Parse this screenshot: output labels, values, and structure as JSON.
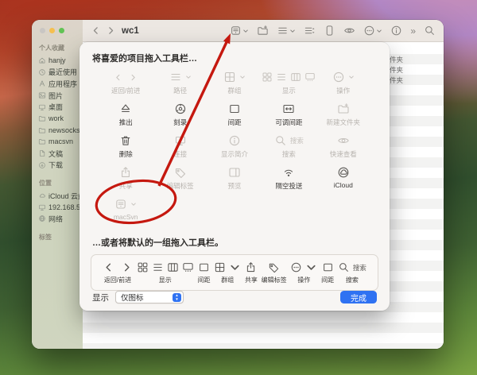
{
  "colors": {
    "accent_blue": "#2f72f2",
    "annotation_red": "#c5180f"
  },
  "window": {
    "title": "wc1",
    "toolbar_items": [
      {
        "id": "macsvn",
        "icon": "app",
        "chevron": true
      },
      {
        "id": "new-folder",
        "icon": "new-folder"
      },
      {
        "id": "path",
        "icon": "list",
        "chevron": true
      },
      {
        "id": "group-sort",
        "icon": "list-sort"
      },
      {
        "id": "space",
        "icon": "space-tall"
      },
      {
        "id": "quick-look",
        "icon": "eye"
      },
      {
        "id": "action",
        "icon": "action",
        "chevron": true
      },
      {
        "id": "get-info",
        "icon": "info"
      },
      {
        "id": "overflow",
        "icon": "overflow"
      },
      {
        "id": "search",
        "icon": "search"
      }
    ]
  },
  "sidebar": {
    "sections": [
      {
        "title": "个人收藏",
        "items": [
          {
            "id": "hanjy",
            "icon": "home",
            "label": "hanjy"
          },
          {
            "id": "recents",
            "icon": "clock",
            "label": "最近使用"
          },
          {
            "id": "applications",
            "icon": "letter-a",
            "label": "应用程序"
          },
          {
            "id": "pictures",
            "icon": "photo",
            "label": "图片"
          },
          {
            "id": "desktop",
            "icon": "desktop",
            "label": "桌面"
          },
          {
            "id": "work",
            "icon": "folder",
            "label": "work"
          },
          {
            "id": "newsocks",
            "icon": "folder",
            "label": "newsocks"
          },
          {
            "id": "macsvn",
            "icon": "folder",
            "label": "macsvn"
          },
          {
            "id": "documents",
            "icon": "document",
            "label": "文稿"
          },
          {
            "id": "downloads",
            "icon": "download",
            "label": "下载"
          }
        ]
      },
      {
        "title": "位置",
        "items": [
          {
            "id": "icloud-drive",
            "icon": "cloud",
            "label": "iCloud 云盘"
          },
          {
            "id": "server",
            "icon": "desktop",
            "label": "192.168.50"
          },
          {
            "id": "network",
            "icon": "globe",
            "label": "网络"
          }
        ]
      },
      {
        "title": "标签",
        "items": []
      }
    ]
  },
  "sheet": {
    "drag_hint": "将喜爱的项目拖入工具栏…",
    "default_hint": "…或者将默认的一组拖入工具栏。",
    "palette": [
      {
        "id": "back-forward",
        "icon": "back-forward",
        "label": "返回/前进",
        "muted": true
      },
      {
        "id": "path",
        "icon": "list",
        "label": "路径",
        "muted": true,
        "chevron": true
      },
      {
        "id": "group",
        "icon": "grid4",
        "label": "群组",
        "muted": true,
        "chevron": true
      },
      {
        "id": "view",
        "icon": "view",
        "label": "显示",
        "muted": true
      },
      {
        "id": "action",
        "icon": "action",
        "label": "操作",
        "muted": true,
        "chevron": true
      },
      {
        "id": "eject",
        "icon": "eject",
        "label": "推出",
        "muted": false
      },
      {
        "id": "burn",
        "icon": "burn",
        "label": "刻录",
        "muted": false
      },
      {
        "id": "space",
        "icon": "space",
        "label": "间距",
        "muted": false
      },
      {
        "id": "flexible-space",
        "icon": "flex-space",
        "label": "可调间距",
        "muted": false
      },
      {
        "id": "new-folder",
        "icon": "new-folder",
        "label": "新建文件夹",
        "muted": true
      },
      {
        "id": "delete",
        "icon": "trash",
        "label": "删除",
        "muted": false
      },
      {
        "id": "connect",
        "icon": "connect",
        "label": "连接",
        "muted": true
      },
      {
        "id": "get-info",
        "icon": "info",
        "label": "显示简介",
        "muted": true
      },
      {
        "id": "search",
        "icon": "search-field",
        "icon_text": "搜索",
        "label": "搜索",
        "muted": true
      },
      {
        "id": "quick-look",
        "icon": "eye",
        "label": "快速查看",
        "muted": true
      },
      {
        "id": "share",
        "icon": "share",
        "label": "共享",
        "muted": true
      },
      {
        "id": "edit-tags",
        "icon": "tag",
        "label": "编辑标签",
        "muted": true
      },
      {
        "id": "preview",
        "icon": "preview",
        "label": "预览",
        "muted": true
      },
      {
        "id": "airdrop",
        "icon": "airdrop",
        "label": "隔空投送",
        "muted": false
      },
      {
        "id": "icloud",
        "icon": "icloud",
        "label": "iCloud",
        "muted": false
      },
      {
        "id": "macsvn",
        "icon": "app",
        "label": "macSvn",
        "muted": true,
        "chevron": true,
        "circled": true
      }
    ],
    "default_set": [
      {
        "id": "back-forward",
        "icon": "back-forward",
        "label": "返回/前进"
      },
      {
        "id": "view",
        "icon": "view",
        "label": "显示"
      },
      {
        "id": "space",
        "icon": "space",
        "label": "间距"
      },
      {
        "id": "group",
        "icon": "grid4",
        "label": "群组",
        "chevron": true
      },
      {
        "id": "share",
        "icon": "share",
        "label": "共享"
      },
      {
        "id": "edit-tags",
        "icon": "tag",
        "label": "编辑标签"
      },
      {
        "id": "action",
        "icon": "action",
        "label": "操作",
        "chevron": true
      },
      {
        "id": "space2",
        "icon": "space",
        "label": "间距"
      },
      {
        "id": "search",
        "icon": "search-field",
        "icon_text": "搜索",
        "label": "搜索"
      }
    ],
    "footer": {
      "show_label": "显示",
      "show_value": "仅图标",
      "done_label": "完成"
    }
  },
  "background_list": {
    "rows": [
      "件夹",
      "件夹",
      "件夹"
    ]
  }
}
